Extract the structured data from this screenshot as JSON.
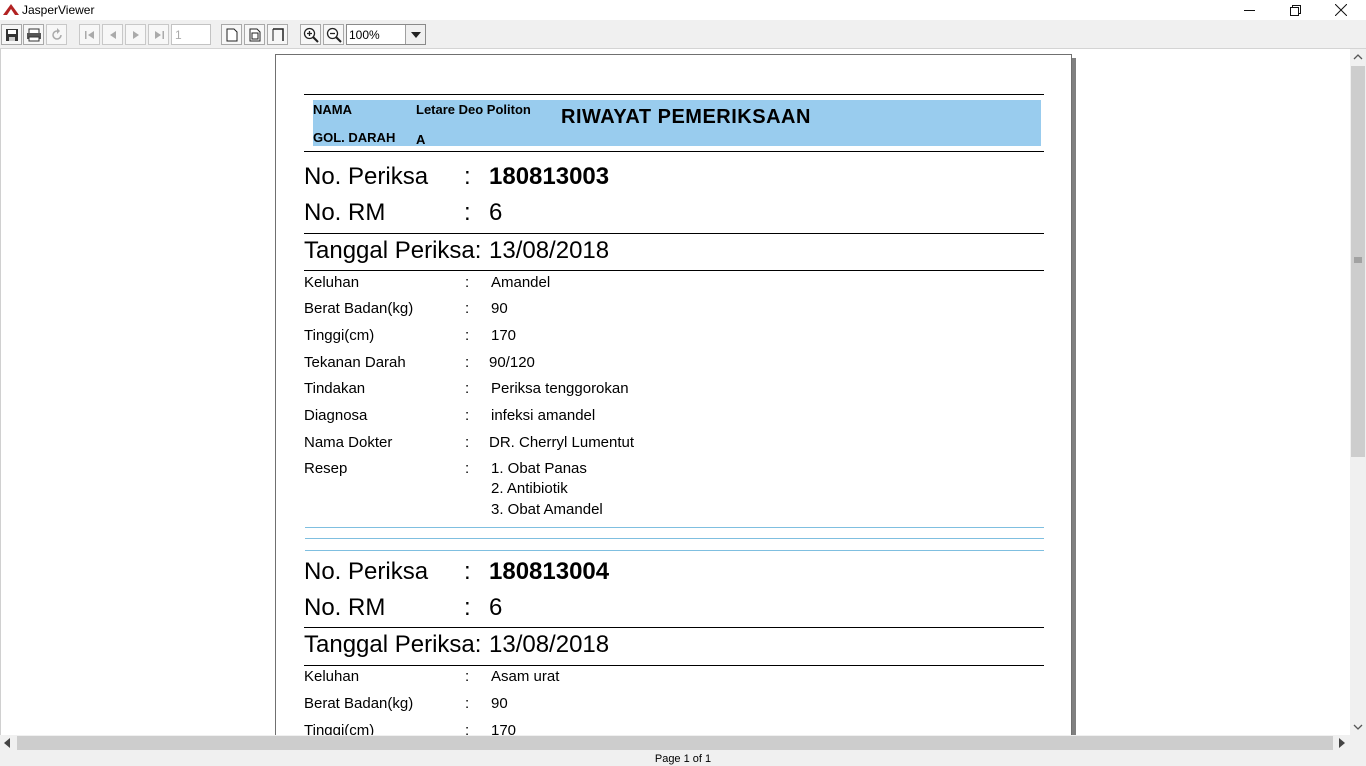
{
  "window": {
    "title": "JasperViewer"
  },
  "toolbar": {
    "page_number": "1",
    "zoom": "100%"
  },
  "report": {
    "header": {
      "name_label": "NAMA",
      "name_value": "Letare Deo Politon",
      "blood_label": "GOL. DARAH",
      "blood_value": "A",
      "title": "RIWAYAT PEMERIKSAAN"
    },
    "colon": ":",
    "labels": {
      "no_periksa": "No. Periksa",
      "no_rm": "No. RM",
      "tanggal": "Tanggal Periksa:",
      "keluhan": "Keluhan",
      "berat": "Berat Badan(kg)",
      "tinggi": "Tinggi(cm)",
      "tekanan": "Tekanan Darah",
      "tindakan": "Tindakan",
      "diagnosa": "Diagnosa",
      "dokter": "Nama Dokter",
      "resep": "Resep"
    },
    "records": [
      {
        "no_periksa": "180813003",
        "no_rm": "6",
        "tanggal": "13/08/2018",
        "keluhan": "Amandel",
        "berat": "90",
        "tinggi": "170",
        "tekanan": "90/120",
        "tindakan": "Periksa tenggorokan",
        "diagnosa": "infeksi amandel",
        "dokter": "DR. Cherryl Lumentut",
        "resep": [
          "1. Obat Panas",
          "2. Antibiotik",
          "3. Obat Amandel"
        ]
      },
      {
        "no_periksa": "180813004",
        "no_rm": "6",
        "tanggal": "13/08/2018",
        "keluhan": "Asam urat",
        "berat": "90",
        "tinggi": "170"
      }
    ]
  },
  "status": {
    "text": "Page 1 of 1"
  }
}
